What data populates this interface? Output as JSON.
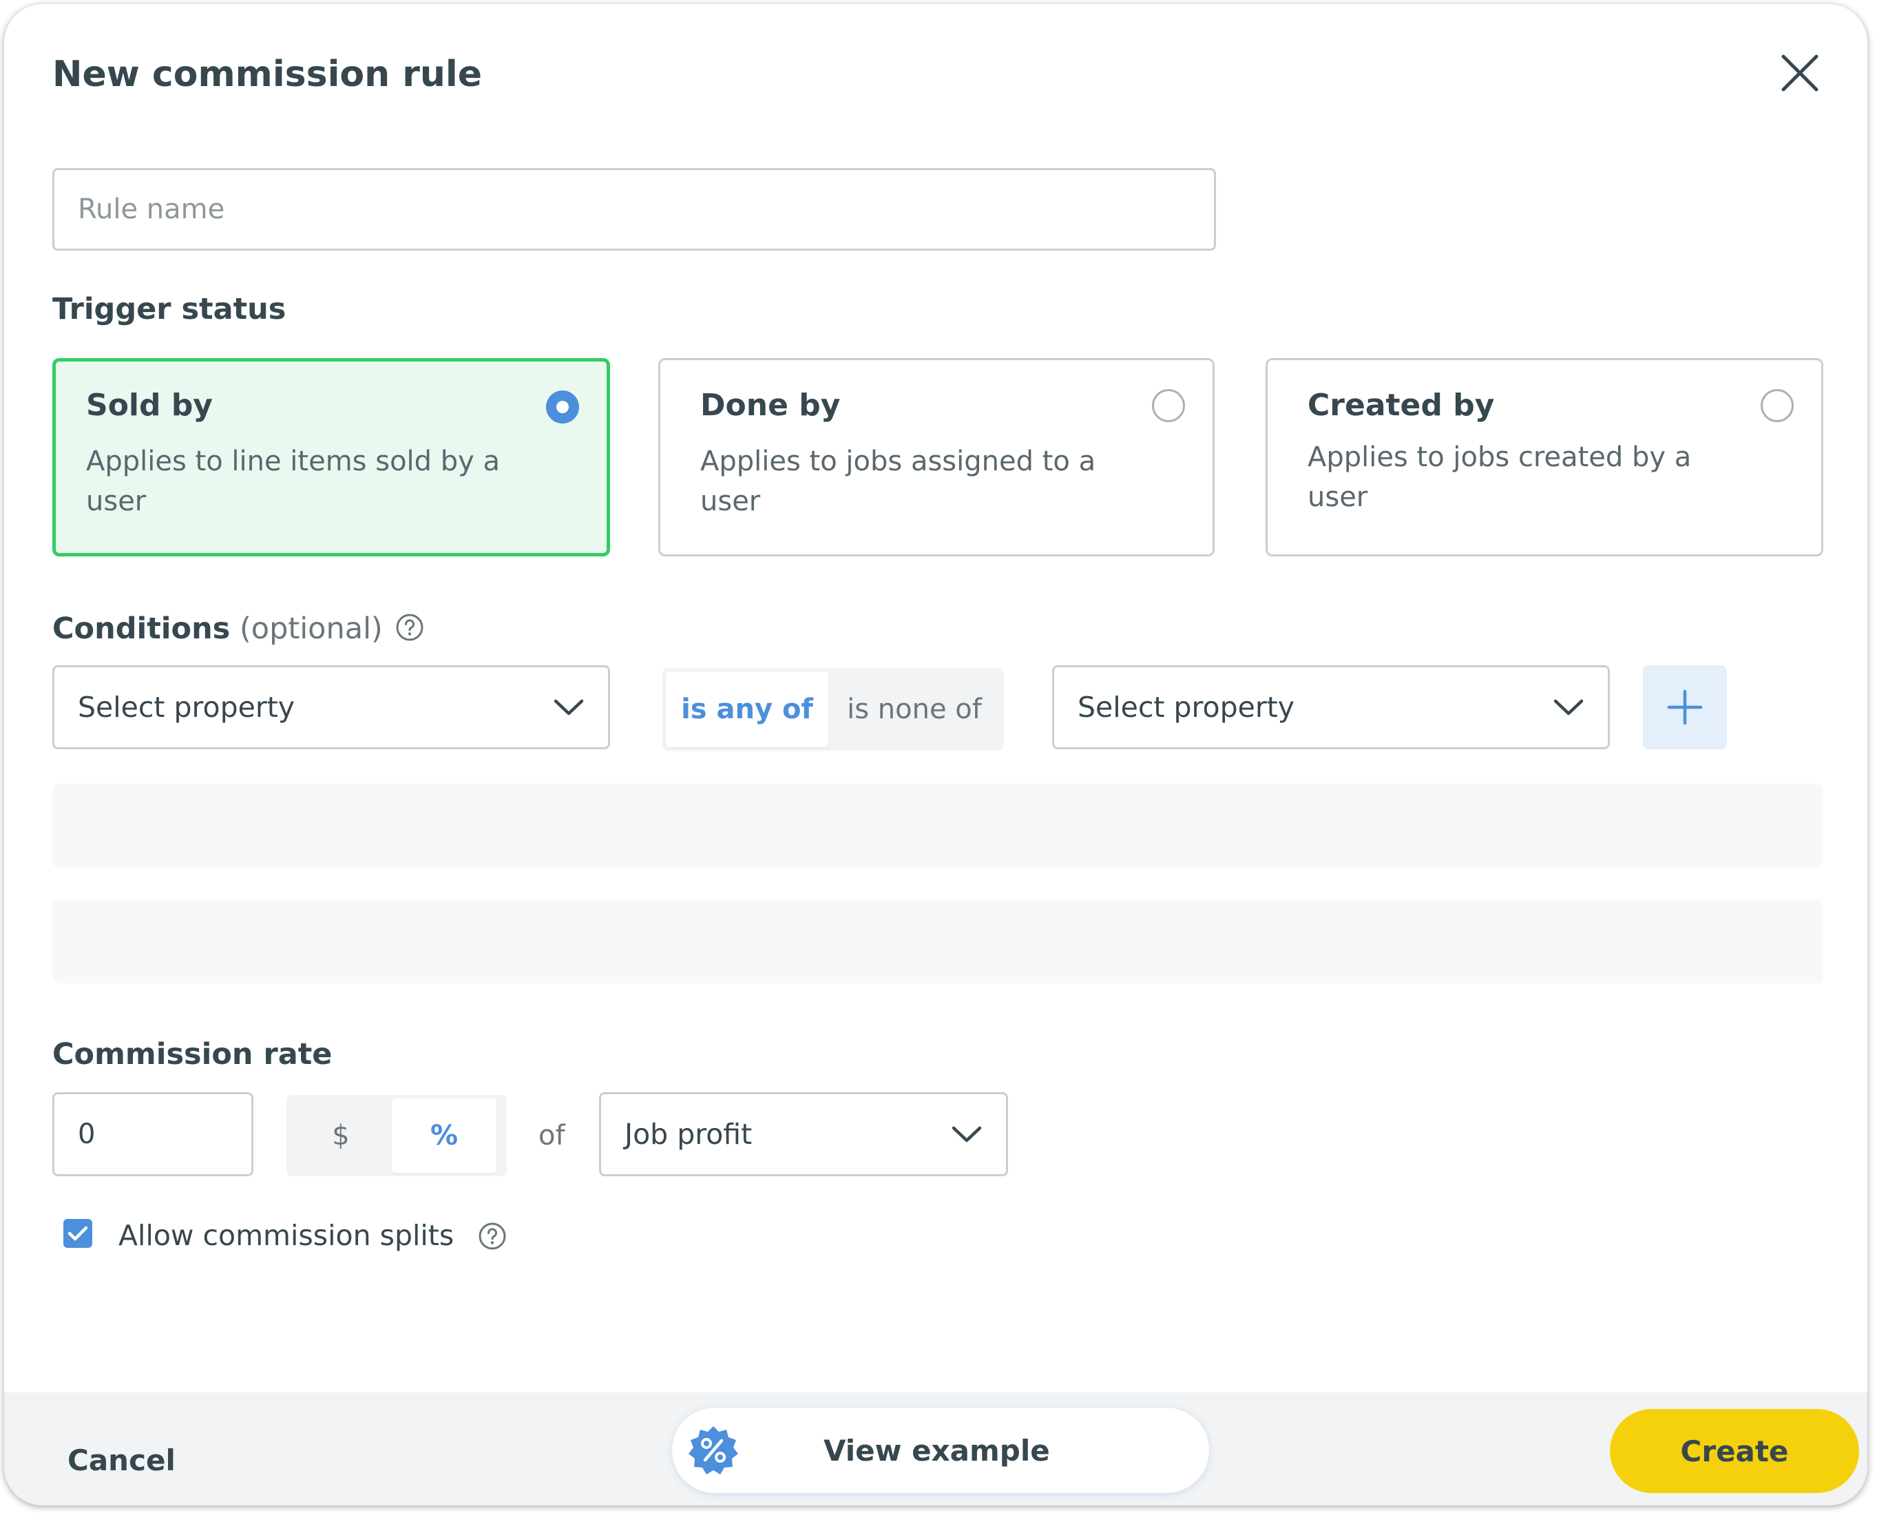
{
  "dialog": {
    "title": "New commission rule",
    "close_icon": "close-icon"
  },
  "rule_name": {
    "value": "",
    "placeholder": "Rule name"
  },
  "trigger_status": {
    "label": "Trigger status",
    "options": [
      {
        "title": "Sold by",
        "description": "Applies to line items sold by a user",
        "selected": true
      },
      {
        "title": "Done by",
        "description": "Applies to jobs assigned to a user",
        "selected": false
      },
      {
        "title": "Created by",
        "description": "Applies to jobs created by a user",
        "selected": false
      }
    ]
  },
  "conditions": {
    "label": "Conditions",
    "optional_label": "(optional)",
    "help_icon": "help-circle-icon",
    "property_select_left": "Select property",
    "operators": [
      {
        "label": "is any of",
        "active": true
      },
      {
        "label": "is none of",
        "active": false
      }
    ],
    "property_select_right": "Select property",
    "add_icon": "plus-icon"
  },
  "commission_rate": {
    "label": "Commission rate",
    "value": "0",
    "units": [
      {
        "label": "$",
        "active": false
      },
      {
        "label": "%",
        "active": true
      }
    ],
    "of_label": "of",
    "basis": "Job profit"
  },
  "allow_splits": {
    "label": "Allow commission splits",
    "checked": true,
    "help_icon": "help-circle-icon"
  },
  "footer": {
    "cancel_label": "Cancel",
    "view_example_label": "View example",
    "view_example_icon": "percent-badge-icon",
    "create_label": "Create"
  },
  "colors": {
    "accent_blue": "#4c8fdb",
    "selected_green": "#33cc66",
    "selected_bg": "#ebf8f0",
    "create_yellow": "#f5d10c",
    "text_dark": "#37474f"
  }
}
